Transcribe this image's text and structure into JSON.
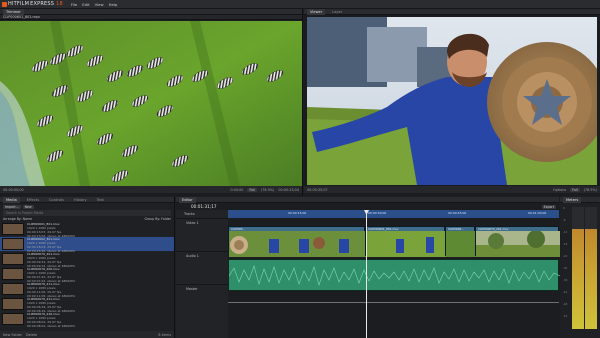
{
  "app": {
    "name": "HITFILM",
    "edition": "EXPRESS",
    "version": "18"
  },
  "menu": [
    "File",
    "Edit",
    "View",
    "Help"
  ],
  "trimmer": {
    "tabs": [
      "Trimmer"
    ],
    "clip_name": "CLIP000601_801.mov",
    "timecode_left": "00:00:00;00",
    "timecode_right": "00:00:23;04",
    "zoom": "(78.9%)",
    "full_label": "Full",
    "start_label": "0:00:00"
  },
  "viewer": {
    "tabs": [
      "Viewer",
      "Layer"
    ],
    "timecode": "00:00:35;07",
    "options_label": "Options",
    "full_label": "Full",
    "zoom": "(78.9%)"
  },
  "media": {
    "tabs": [
      "Media",
      "Effects",
      "Controls",
      "History",
      "Text"
    ],
    "import_label": "Import...",
    "new_label": "New",
    "search_placeholder": "Search in Project Media",
    "arrange_label": "Arrange By: Name",
    "group_label": "Group By: Folder",
    "items": [
      {
        "name": "CLIP000601_801.mov",
        "line1": "1920 x 1080 pixels",
        "line2": "00:00:13;07, 29.97 fps",
        "line3": "00:00:23;04, stereo at 48000Hz"
      },
      {
        "name": "CLIP000602_301.mov",
        "line1": "1920 x 1080 pixels",
        "line2": "00:00:18;03, 29.97 fps",
        "line3": "00:00:25;20, stereo at 48000Hz"
      },
      {
        "name": "CLIP000679_201.mov",
        "line1": "1920 x 1080 pixels",
        "line2": "00:00:09;12, 29.97 fps",
        "line3": "00:00:09;12, stereo at 48000Hz"
      },
      {
        "name": "CLIP000679_206.mov",
        "line1": "1920 x 1080 pixels",
        "line2": "00:00:07;22, 29.97 fps",
        "line3": "00:00:07;22, stereo at 48000Hz"
      },
      {
        "name": "CLIP000679_211.mov",
        "line1": "1920 x 1080 pixels",
        "line2": "00:00:11;05, 29.97 fps",
        "line3": "00:00:11;05, stereo at 48000Hz"
      },
      {
        "name": "CLIP000679_221.mov",
        "line1": "1920 x 1080 pixels",
        "line2": "00:00:06;19, 29.97 fps",
        "line3": "00:00:06;19, stereo at 48000Hz"
      },
      {
        "name": "CLIP000679_226.mov",
        "line1": "1920 x 1080 pixels",
        "line2": "00:00:08;02, 29.97 fps",
        "line3": "00:00:08;02, stereo at 48000Hz"
      }
    ],
    "new_folder_label": "New Folder",
    "delete_label": "Delete",
    "count_label": "8 items"
  },
  "editor": {
    "tabs": [
      "Editor"
    ],
    "timecode": "00:01:31;17",
    "export_label": "Export",
    "tracks_label": "Tracks",
    "video_track": "Video 1",
    "audio_track": "Audio 1",
    "master_track": "Master",
    "ruler": [
      "00:00:15;00",
      "00:00:30;00",
      "00:00:45;00",
      "00:01:00;00"
    ],
    "clip_labels": [
      "CLIP000...",
      "CLIP000601_801.mov",
      "CLIP0006...",
      "CLIP000679_201.mov"
    ]
  },
  "meters": {
    "tab": "Meters",
    "scale": [
      "0",
      "-6",
      "-12",
      "-18",
      "-24",
      "-30",
      "-36",
      "-42",
      "-48",
      "-54"
    ],
    "level_left": 0.82,
    "level_right": 0.82
  },
  "colors": {
    "accent": "#e85a1c",
    "selection": "#2f4d8a",
    "audio": "#2f8f6a",
    "video_clip": "#3e6c8a"
  }
}
